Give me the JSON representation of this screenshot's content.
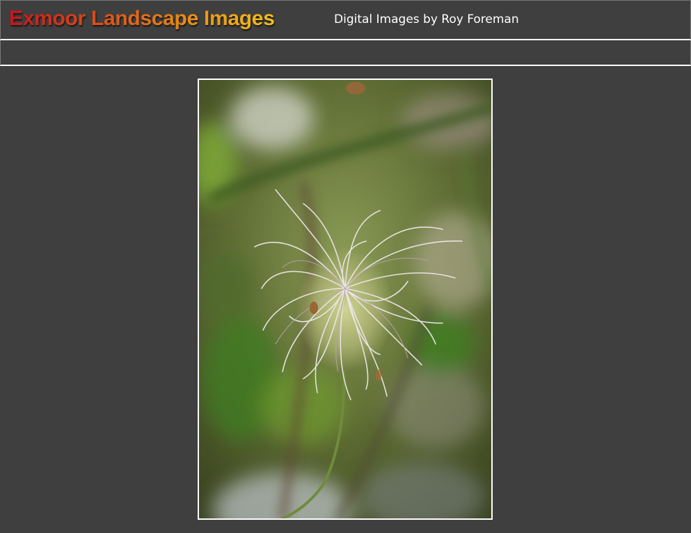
{
  "header": {
    "site_title": "Exmoor Landscape Images",
    "subtitle": "Digital Images by Roy Foreman"
  },
  "photo": {
    "subject": "seed-head-photo"
  },
  "colors": {
    "page_bg": "#3f3f3f",
    "rule": "#ffffff",
    "title_gradient_start": "#c8141c",
    "title_gradient_end": "#f2bf18",
    "subtitle": "#ffffff"
  }
}
